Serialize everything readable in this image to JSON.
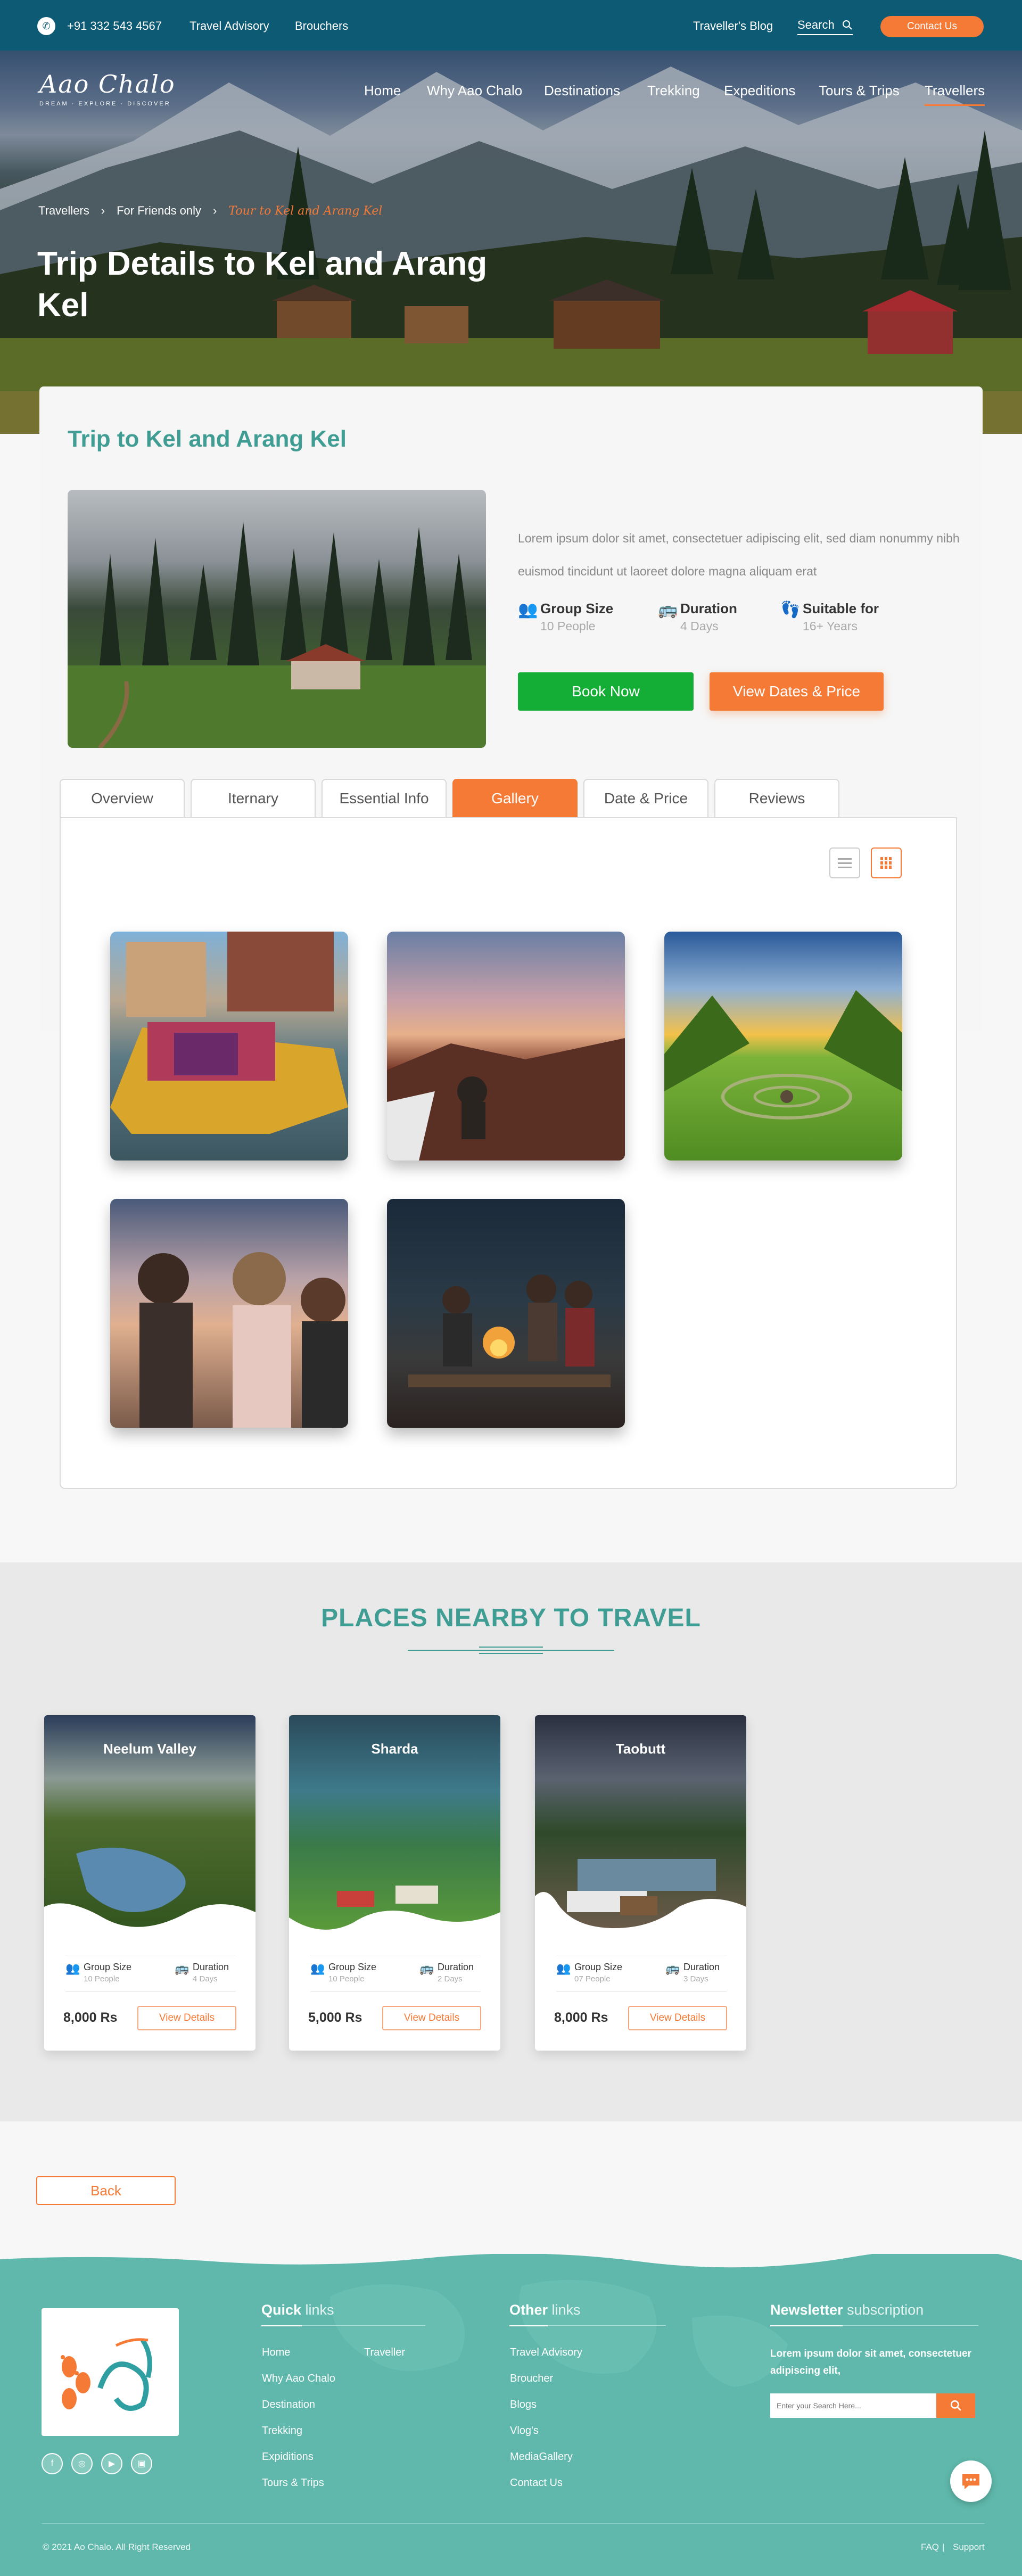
{
  "topbar": {
    "phone": "+91 332 543 4567",
    "links": [
      "Travel Advisory",
      "Brouchers"
    ],
    "blog": "Traveller's Blog",
    "search_label": "Search",
    "contact_button": "Contact Us"
  },
  "brand": {
    "logo_text": "Aao Chalo",
    "tagline": "DREAM · EXPLORE · DISCOVER"
  },
  "nav": {
    "items": [
      "Home",
      "Why Aao Chalo",
      "Destinations",
      "Trekking",
      "Expeditions",
      "Tours & Trips",
      "Travellers"
    ],
    "active": "Travellers"
  },
  "breadcrumb": {
    "items": [
      "Travellers",
      "For Friends only",
      "Tour to Kel and Arang Kel"
    ],
    "separator": "›"
  },
  "hero": {
    "title": "Trip Details to Kel and Arang Kel"
  },
  "trip": {
    "heading": "Trip to Kel and Arang Kel",
    "description": "Lorem ipsum dolor sit amet, consectetuer adipiscing elit, sed diam nonummy nibh euismod tincidunt ut laoreet dolore magna aliquam erat",
    "stats": [
      {
        "label": "Group Size",
        "value": "10 People",
        "icon": "group-icon"
      },
      {
        "label": "Duration",
        "value": "4 Days",
        "icon": "bus-icon"
      },
      {
        "label": "Suitable for",
        "value": "16+ Years",
        "icon": "footprints-icon"
      }
    ],
    "book_button": "Book Now",
    "dates_button": "View Dates & Price"
  },
  "tabs": {
    "items": [
      "Overview",
      "Iternary",
      "Essential Info",
      "Gallery",
      "Date & Price",
      "Reviews"
    ],
    "active": "Gallery"
  },
  "gallery": {
    "images": [
      "houseboat-photo",
      "sunset-cliff-photo",
      "green-valley-photo",
      "friends-photo",
      "campfire-photo"
    ]
  },
  "nearby": {
    "title": "PLACES NEARBY TO TRAVEL",
    "group_label": "Group Size",
    "duration_label": "Duration",
    "view_details": "View Details",
    "places": [
      {
        "name": "Neelum Valley",
        "group": "10 People",
        "duration": "4 Days",
        "price": "8,000 Rs"
      },
      {
        "name": "Sharda",
        "group": "10 People",
        "duration": "2 Days",
        "price": "5,000 Rs"
      },
      {
        "name": "Taobutt",
        "group": "07 People",
        "duration": "3 Days",
        "price": "8,000 Rs"
      }
    ]
  },
  "back_button": "Back",
  "footer": {
    "quick_links": {
      "title_bold": "Quick",
      "title_rest": "links",
      "col1": [
        "Home",
        "Why Aao Chalo",
        "Destination",
        "Trekking",
        "Expiditions",
        "Tours & Trips"
      ],
      "col2": [
        "Traveller"
      ]
    },
    "other_links": {
      "title_bold": "Other",
      "title_rest": "links",
      "items": [
        "Travel Advisory",
        "Broucher",
        "Blogs",
        "Vlog's",
        "MediaGallery",
        "Contact Us"
      ]
    },
    "newsletter": {
      "title_bold": "Newsletter",
      "title_rest": "subscription",
      "text": "Lorem ipsum dolor sit amet, consectetuer adipiscing elit,",
      "placeholder": "Enter your Search Here..."
    },
    "copyright": "© 2021 Ao Chalo. All Right Reserved",
    "legal": [
      "FAQ",
      "Support"
    ],
    "legal_separator": "|"
  },
  "colors": {
    "teal": "#3f9d94",
    "orange": "#f47a36",
    "green": "#14ad35",
    "topbar": "#0d5a75",
    "footer": "#5fb8ab"
  }
}
